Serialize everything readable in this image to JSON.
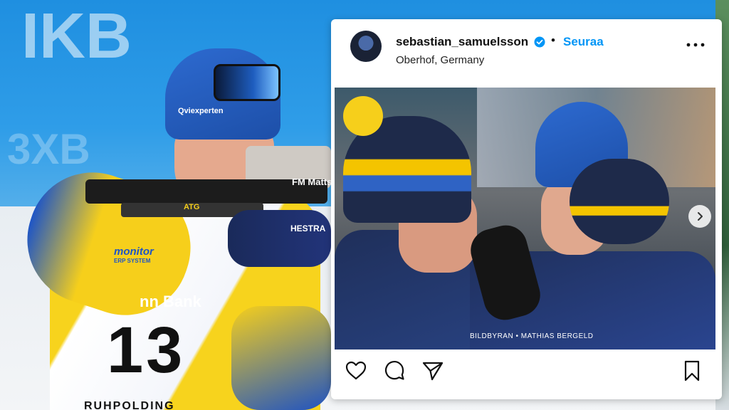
{
  "background": {
    "wall_logos": [
      "IKB",
      "3XB"
    ],
    "bib_number": "13",
    "sponsors": {
      "helmet": "Qviexperten",
      "chest": "monitor",
      "chest_sub": "ERP SYSTEM",
      "belly": "nn Bank",
      "rifle_tag": "ATG",
      "rifle_brand": "FM Matts",
      "glove": "HESTRA",
      "bottom": "RUHPOLDING"
    }
  },
  "post": {
    "username": "sebastian_samuelsson",
    "separator": "•",
    "follow_label": "Seuraa",
    "location": "Oberhof, Germany",
    "image_credit": "BILDBYRAN • MATHIAS BERGELD"
  },
  "icons": {
    "verified": "verified-badge-icon",
    "more": "more-options-icon",
    "next": "chevron-right-icon",
    "like": "heart-icon",
    "comment": "comment-icon",
    "share": "send-icon",
    "save": "bookmark-icon"
  },
  "colors": {
    "follow": "#0095f6",
    "verified": "#0095f6",
    "sweden_blue": "#1e55c6",
    "sweden_yellow": "#f6cf1b"
  }
}
